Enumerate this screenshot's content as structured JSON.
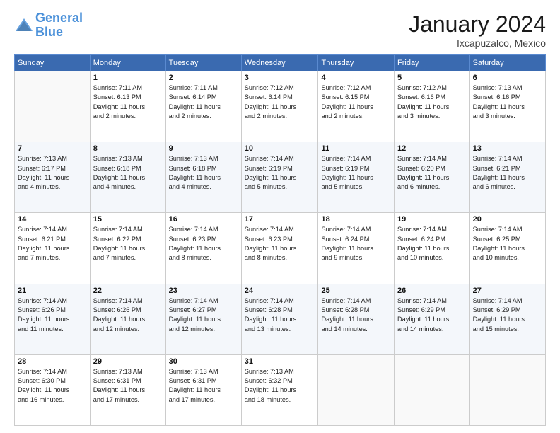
{
  "header": {
    "logo_line1": "General",
    "logo_line2": "Blue",
    "title": "January 2024",
    "location": "Ixcapuzalco, Mexico"
  },
  "days_of_week": [
    "Sunday",
    "Monday",
    "Tuesday",
    "Wednesday",
    "Thursday",
    "Friday",
    "Saturday"
  ],
  "weeks": [
    [
      {
        "day": "",
        "info": ""
      },
      {
        "day": "1",
        "info": "Sunrise: 7:11 AM\nSunset: 6:13 PM\nDaylight: 11 hours\nand 2 minutes."
      },
      {
        "day": "2",
        "info": "Sunrise: 7:11 AM\nSunset: 6:14 PM\nDaylight: 11 hours\nand 2 minutes."
      },
      {
        "day": "3",
        "info": "Sunrise: 7:12 AM\nSunset: 6:14 PM\nDaylight: 11 hours\nand 2 minutes."
      },
      {
        "day": "4",
        "info": "Sunrise: 7:12 AM\nSunset: 6:15 PM\nDaylight: 11 hours\nand 2 minutes."
      },
      {
        "day": "5",
        "info": "Sunrise: 7:12 AM\nSunset: 6:16 PM\nDaylight: 11 hours\nand 3 minutes."
      },
      {
        "day": "6",
        "info": "Sunrise: 7:13 AM\nSunset: 6:16 PM\nDaylight: 11 hours\nand 3 minutes."
      }
    ],
    [
      {
        "day": "7",
        "info": "Sunrise: 7:13 AM\nSunset: 6:17 PM\nDaylight: 11 hours\nand 4 minutes."
      },
      {
        "day": "8",
        "info": "Sunrise: 7:13 AM\nSunset: 6:18 PM\nDaylight: 11 hours\nand 4 minutes."
      },
      {
        "day": "9",
        "info": "Sunrise: 7:13 AM\nSunset: 6:18 PM\nDaylight: 11 hours\nand 4 minutes."
      },
      {
        "day": "10",
        "info": "Sunrise: 7:14 AM\nSunset: 6:19 PM\nDaylight: 11 hours\nand 5 minutes."
      },
      {
        "day": "11",
        "info": "Sunrise: 7:14 AM\nSunset: 6:19 PM\nDaylight: 11 hours\nand 5 minutes."
      },
      {
        "day": "12",
        "info": "Sunrise: 7:14 AM\nSunset: 6:20 PM\nDaylight: 11 hours\nand 6 minutes."
      },
      {
        "day": "13",
        "info": "Sunrise: 7:14 AM\nSunset: 6:21 PM\nDaylight: 11 hours\nand 6 minutes."
      }
    ],
    [
      {
        "day": "14",
        "info": "Sunrise: 7:14 AM\nSunset: 6:21 PM\nDaylight: 11 hours\nand 7 minutes."
      },
      {
        "day": "15",
        "info": "Sunrise: 7:14 AM\nSunset: 6:22 PM\nDaylight: 11 hours\nand 7 minutes."
      },
      {
        "day": "16",
        "info": "Sunrise: 7:14 AM\nSunset: 6:23 PM\nDaylight: 11 hours\nand 8 minutes."
      },
      {
        "day": "17",
        "info": "Sunrise: 7:14 AM\nSunset: 6:23 PM\nDaylight: 11 hours\nand 8 minutes."
      },
      {
        "day": "18",
        "info": "Sunrise: 7:14 AM\nSunset: 6:24 PM\nDaylight: 11 hours\nand 9 minutes."
      },
      {
        "day": "19",
        "info": "Sunrise: 7:14 AM\nSunset: 6:24 PM\nDaylight: 11 hours\nand 10 minutes."
      },
      {
        "day": "20",
        "info": "Sunrise: 7:14 AM\nSunset: 6:25 PM\nDaylight: 11 hours\nand 10 minutes."
      }
    ],
    [
      {
        "day": "21",
        "info": "Sunrise: 7:14 AM\nSunset: 6:26 PM\nDaylight: 11 hours\nand 11 minutes."
      },
      {
        "day": "22",
        "info": "Sunrise: 7:14 AM\nSunset: 6:26 PM\nDaylight: 11 hours\nand 12 minutes."
      },
      {
        "day": "23",
        "info": "Sunrise: 7:14 AM\nSunset: 6:27 PM\nDaylight: 11 hours\nand 12 minutes."
      },
      {
        "day": "24",
        "info": "Sunrise: 7:14 AM\nSunset: 6:28 PM\nDaylight: 11 hours\nand 13 minutes."
      },
      {
        "day": "25",
        "info": "Sunrise: 7:14 AM\nSunset: 6:28 PM\nDaylight: 11 hours\nand 14 minutes."
      },
      {
        "day": "26",
        "info": "Sunrise: 7:14 AM\nSunset: 6:29 PM\nDaylight: 11 hours\nand 14 minutes."
      },
      {
        "day": "27",
        "info": "Sunrise: 7:14 AM\nSunset: 6:29 PM\nDaylight: 11 hours\nand 15 minutes."
      }
    ],
    [
      {
        "day": "28",
        "info": "Sunrise: 7:14 AM\nSunset: 6:30 PM\nDaylight: 11 hours\nand 16 minutes."
      },
      {
        "day": "29",
        "info": "Sunrise: 7:13 AM\nSunset: 6:31 PM\nDaylight: 11 hours\nand 17 minutes."
      },
      {
        "day": "30",
        "info": "Sunrise: 7:13 AM\nSunset: 6:31 PM\nDaylight: 11 hours\nand 17 minutes."
      },
      {
        "day": "31",
        "info": "Sunrise: 7:13 AM\nSunset: 6:32 PM\nDaylight: 11 hours\nand 18 minutes."
      },
      {
        "day": "",
        "info": ""
      },
      {
        "day": "",
        "info": ""
      },
      {
        "day": "",
        "info": ""
      }
    ]
  ]
}
